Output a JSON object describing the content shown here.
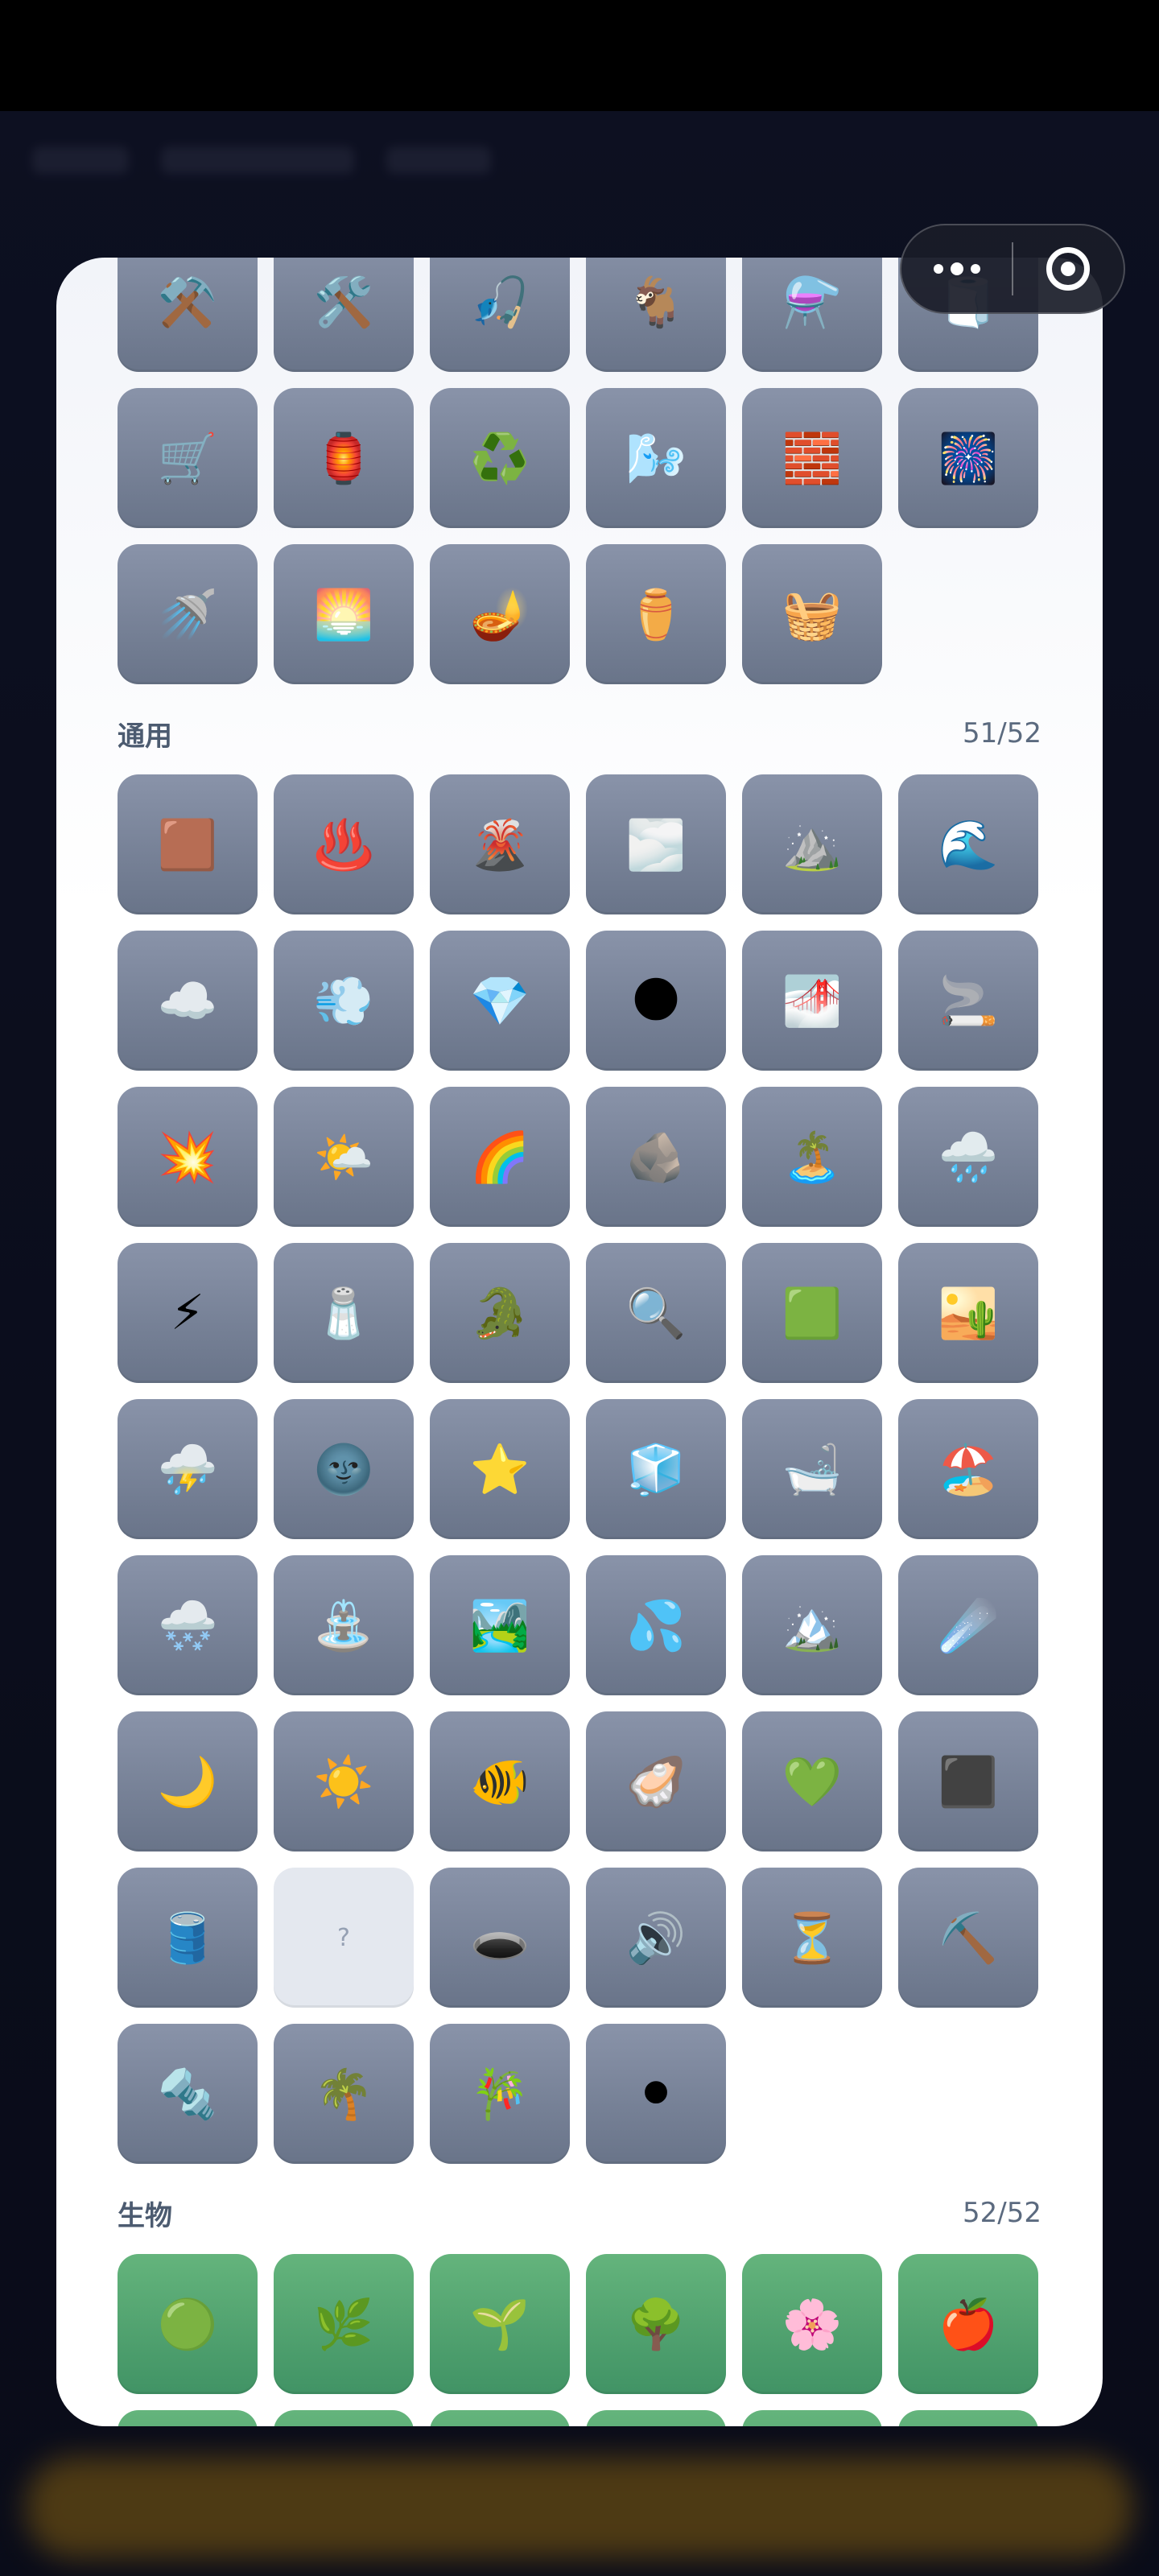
{
  "top_items": [
    "⚒️",
    "🛠️",
    "🎣",
    "🐐",
    "⚗️",
    "🧻",
    "🛒",
    "🏮",
    "♻️",
    "🌬️",
    "🧱",
    "🎆",
    "🚿",
    "🌅",
    "🪔",
    "⚱️",
    "🧺"
  ],
  "sections": [
    {
      "title": "通用",
      "count": "51/52",
      "items": [
        "🟫",
        "♨️",
        "🌋",
        "🌫️",
        "⛰️",
        "🌊",
        "☁️",
        "💨",
        "💎",
        "🌑",
        "🌁",
        "🚬",
        "💥",
        "🌤️",
        "🌈",
        "🪨",
        "🏝️",
        "🌧️",
        "⚡",
        "🧂",
        "🐊",
        "🔍",
        "🟩",
        "🏜️",
        "⛈️",
        "🌚",
        "⭐",
        "🧊",
        "🛁",
        "🏖️",
        "🌨️",
        "⛲",
        "🏞️",
        "💦",
        "🏔️",
        "☄️",
        "🌙",
        "☀️",
        "🐠",
        "🦪",
        "💚",
        "⬛",
        "🛢️",
        "?",
        "🕳️",
        "🔊",
        "⏳",
        "⛏️",
        "🔩",
        "🌴",
        "🎋",
        "⚫"
      ],
      "empty_items": [
        43
      ]
    },
    {
      "title": "生物",
      "count": "52/52",
      "items": [
        "🟢",
        "🌿",
        "🌱",
        "🌳",
        "🌸",
        "🍎",
        "",
        "",
        "",
        "",
        "",
        ""
      ]
    }
  ],
  "colors": {
    "tile": "#7c86a0",
    "tile_empty": "#e4e8ef",
    "tile_bio": "#52a872",
    "section_text": "#4c5b70"
  },
  "icons": {
    "capsule_more": "more-dots-icon",
    "capsule_close": "target-close-icon"
  }
}
